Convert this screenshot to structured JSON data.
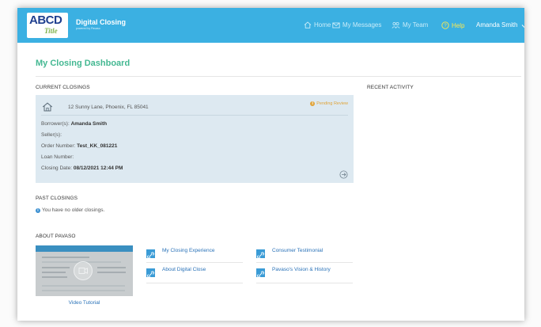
{
  "header": {
    "logo_text": "ABCD",
    "logo_subtext": "Title",
    "app_title": "Digital Closing",
    "app_subtitle": "powered by Pavaso",
    "nav": {
      "home": "Home",
      "messages": "My Messages",
      "team": "My Team",
      "help": "Help",
      "user": "Amanda Smith"
    }
  },
  "page_title": "My Closing Dashboard",
  "current_closings": {
    "label": "CURRENT CLOSINGS",
    "card": {
      "address": "12 Sunny Lane, Phoenix, FL 85041",
      "status": "Pending Review",
      "borrower_label": "Borrower(s):",
      "borrower_value": "Amanda Smith",
      "seller_label": "Seller(s):",
      "seller_value": "",
      "order_label": "Order Number:",
      "order_value": "Test_KK_081221",
      "loan_label": "Loan Number:",
      "loan_value": "",
      "date_label": "Closing Date:",
      "date_value": "08/12/2021 12:44 PM"
    }
  },
  "recent_activity": {
    "label": "RECENT ACTIVITY"
  },
  "past_closings": {
    "label": "PAST CLOSINGS",
    "message": "You have no older closings."
  },
  "about": {
    "label": "ABOUT PAVASO",
    "video_caption": "Video Tutorial",
    "links": [
      "My Closing Experience",
      "Consumer Testimonial",
      "About Digital Close",
      "Pavaso's Vision & History"
    ]
  },
  "colors": {
    "header_bg": "#3bb0e2",
    "title_green": "#44b892",
    "card_bg": "#dde9f1",
    "status_orange": "#e0a43a",
    "link_blue": "#2a72b8",
    "help_yellow": "#ffe94d"
  },
  "icons": {
    "home": "home-icon",
    "messages": "envelope-icon",
    "team": "team-icon",
    "help": "help-circle-icon",
    "user_menu": "chevron-down-icon",
    "address": "house-icon",
    "status": "info-icon",
    "card_action": "arrow-circle-right-icon",
    "info": "info-icon",
    "video": "video-camera-icon",
    "link": "link-icon"
  }
}
